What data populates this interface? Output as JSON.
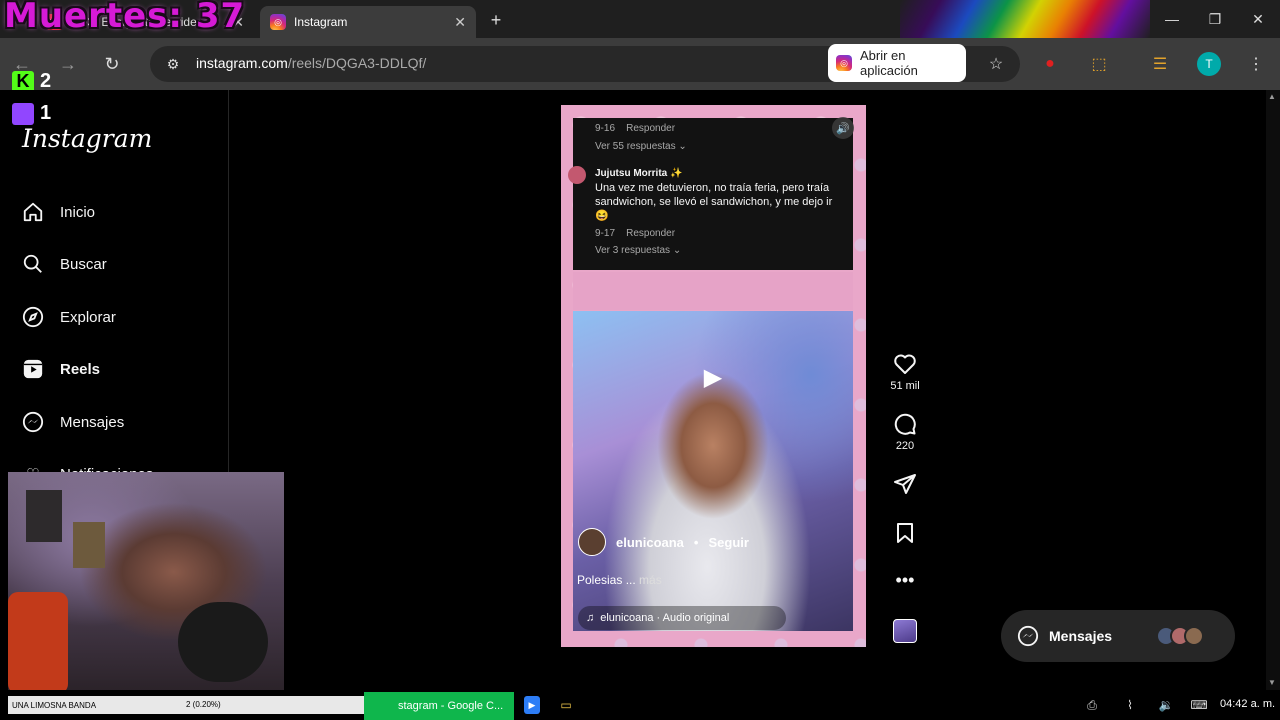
{
  "browser": {
    "tabs": [
      {
        "title": "(193) E inquietante vide",
        "favicon": "youtube-icon"
      },
      {
        "title": "Instagram",
        "favicon": "instagram-icon"
      }
    ],
    "url_domain": "instagram.com",
    "url_path": "/reels/DQGA3-DDLQf/",
    "open_in_app_label": "Abrir en aplicación",
    "profile_initial": "T"
  },
  "overlay": {
    "muertes_label": "Muertes: 37",
    "kick_count": "2",
    "twitch_count": "1",
    "streamer_name": "UNA LIMOSNA BANDA",
    "donation": "2 (0.20%)"
  },
  "sidebar": {
    "logo": "Instagram",
    "items": [
      {
        "label": "Inicio",
        "icon": "home-icon"
      },
      {
        "label": "Buscar",
        "icon": "search-icon"
      },
      {
        "label": "Explorar",
        "icon": "compass-icon"
      },
      {
        "label": "Reels",
        "icon": "reels-icon"
      },
      {
        "label": "Mensajes",
        "icon": "messenger-icon"
      },
      {
        "label": "Notificaciones",
        "icon": "heart-icon"
      }
    ]
  },
  "reel": {
    "comments": [
      {
        "time": "9-16",
        "reply": "Responder",
        "more_replies": "Ver 55 respuestas ⌄"
      },
      {
        "user": "Jujutsu Morrita ✨",
        "text": "Una vez me detuvieron, no traía feria, pero traía sandwichon, se llevó el sandwichon, y me dejo ir 😆",
        "time": "9-17",
        "reply": "Responder",
        "more_replies": "Ver 3 respuestas ⌄"
      }
    ],
    "owner": "elunicoana",
    "follow_label": "Seguir",
    "caption": "Polesias ...",
    "caption_more": "más",
    "audio": "elunicoana · Audio original"
  },
  "actions": {
    "likes": "51 mil",
    "comments": "220"
  },
  "messages_pill": {
    "label": "Mensajes"
  },
  "taskbar": {
    "active_window": "stagram - Google C...",
    "time": "04:42 a. m."
  }
}
